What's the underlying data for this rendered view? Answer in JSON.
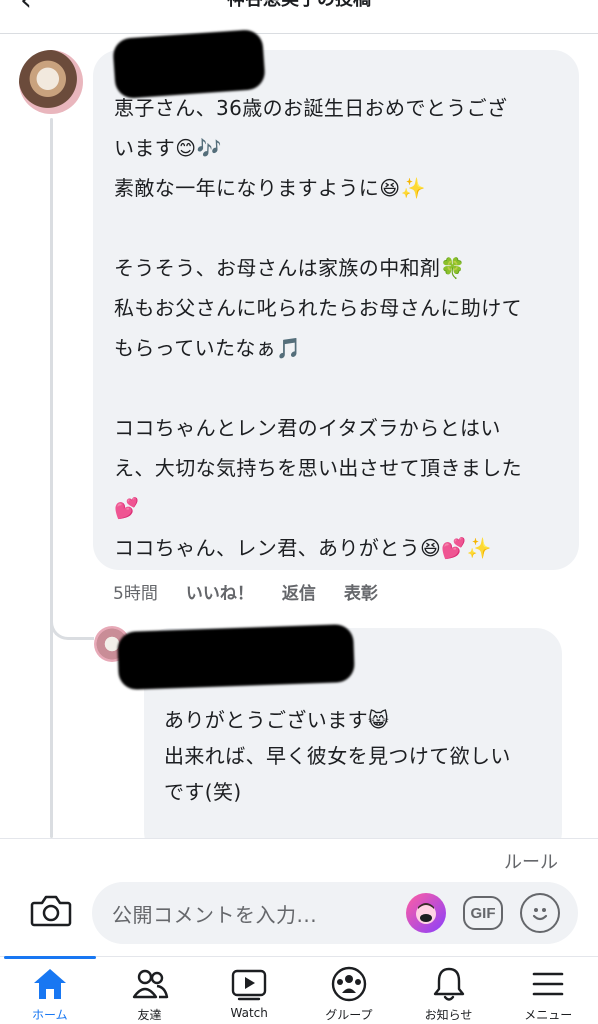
{
  "header": {
    "back_icon": "back-arrow-icon",
    "title": "神谷恵美子の投稿"
  },
  "comments": [
    {
      "lines": [
        "恵子さん、36歳のお誕生日おめでとうござ",
        "います😊🎶",
        "素敵な一年になりますように😆✨",
        "",
        "そうそう、お母さんは家族の中和剤🍀",
        "私もお父さんに叱られたらお母さんに助けて",
        "もらっていたなぁ🎵",
        "",
        "ココちゃんとレン君のイタズラからとはい",
        "え、大切な気持ちを思い出させて頂きました",
        "💕",
        "ココちゃん、レン君、ありがとう😆💕✨"
      ],
      "time": "5時間",
      "like": "いいね！",
      "reply": "返信",
      "award": "表彰"
    },
    {
      "lines": [
        "ありがとうございます😸",
        "出来れば、早く彼女を見つけて欲しい",
        "です(笑)"
      ]
    }
  ],
  "composer": {
    "rules": "ルール",
    "placeholder": "公開コメントを入力...",
    "gif": "GIF",
    "camera_icon": "camera-icon",
    "avatar_icon": "avatar-sticker-icon",
    "emoji_icon": "emoji-icon"
  },
  "nav": {
    "items": [
      {
        "label": "ホーム",
        "icon": "home-icon",
        "active": true
      },
      {
        "label": "友達",
        "icon": "friends-icon"
      },
      {
        "label": "Watch",
        "icon": "watch-icon"
      },
      {
        "label": "グループ",
        "icon": "groups-icon"
      },
      {
        "label": "お知らせ",
        "icon": "bell-icon"
      },
      {
        "label": "メニュー",
        "icon": "menu-icon"
      }
    ]
  },
  "colors": {
    "accent": "#1877f2",
    "bubble": "#f0f2f5",
    "muted": "#65676b"
  }
}
